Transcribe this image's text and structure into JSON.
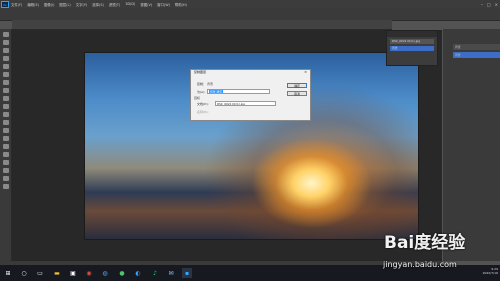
{
  "menubar": {
    "app_icon": "Ps",
    "items": [
      "文件(F)",
      "编辑(E)",
      "图像(I)",
      "图层(L)",
      "文字(Y)",
      "选择(S)",
      "滤镜(T)",
      "3D(D)",
      "视图(V)",
      "窗口(W)",
      "帮助(H)"
    ],
    "window_controls": [
      "–",
      "□",
      "×"
    ]
  },
  "layers_panel": {
    "rows": [
      "DSC_0021 IIC(1).jpg",
      "背景"
    ]
  },
  "right_panel": {
    "rows": [
      "背景",
      "背景"
    ]
  },
  "dialog": {
    "title": "复制图层",
    "copy_label": "复制：",
    "copy_value": "背景",
    "as_label": "为(A):",
    "as_value": "背景 拷贝",
    "target_section": "目标",
    "document_label": "文档(D):",
    "document_value": "DSC_0021 IIC(1).jpg",
    "name_label": "名称(N):",
    "ok_label": "确定",
    "cancel_label": "取消"
  },
  "taskbar": {
    "icons": [
      "windows-logo-icon",
      "search-icon",
      "task-view-icon",
      "file-explorer-icon",
      "store-icon",
      "chrome-icon",
      "browser-icon",
      "wechat-icon",
      "qq-icon",
      "music-icon",
      "mail-icon",
      "photoshop-icon"
    ],
    "time": "9:29",
    "date": "2020/7/16"
  },
  "watermark": {
    "logo": "Bai度经验",
    "url": "jingyan.baidu.com"
  }
}
